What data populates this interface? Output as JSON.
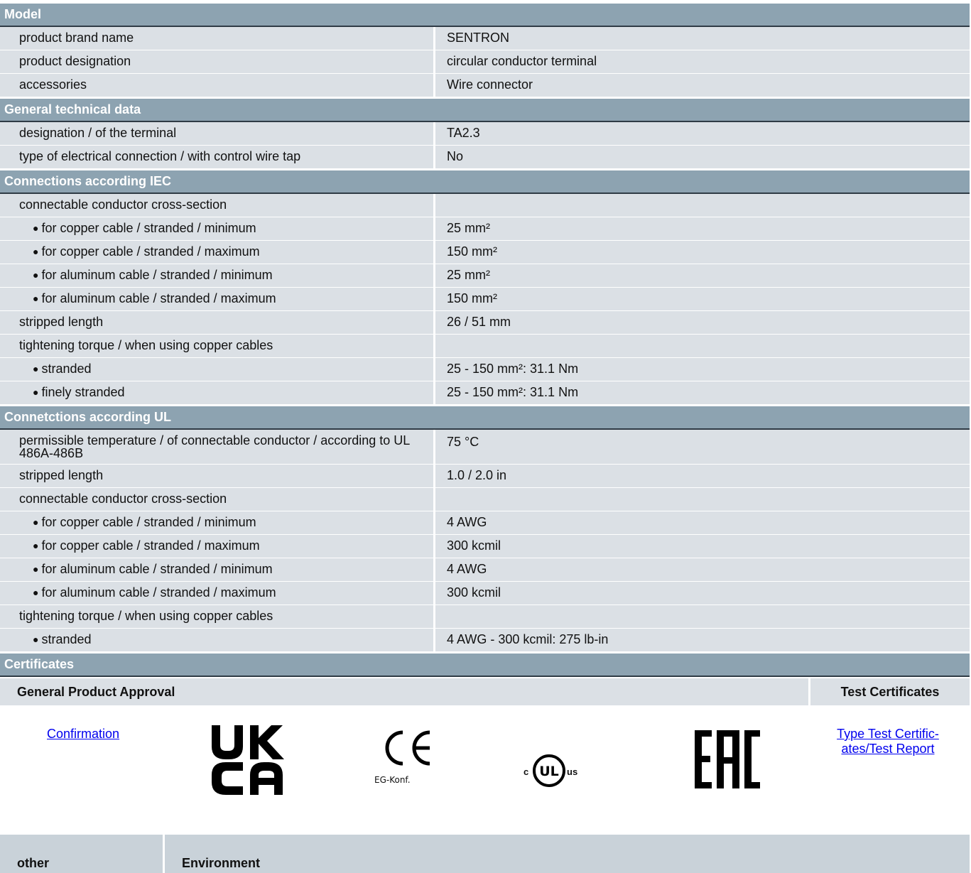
{
  "sections": {
    "model": {
      "title": "Model",
      "rows": [
        {
          "label": "product brand name",
          "value": "SENTRON"
        },
        {
          "label": "product designation",
          "value": "circular conductor terminal"
        },
        {
          "label": "accessories",
          "value": "Wire connector"
        }
      ]
    },
    "general": {
      "title": "General technical data",
      "rows": [
        {
          "label": "designation / of the terminal",
          "value": "TA2.3"
        },
        {
          "label": "type of electrical connection / with control wire tap",
          "value": "No"
        }
      ]
    },
    "iec": {
      "title": "Connections according IEC",
      "cross_section_label": "connectable conductor cross-section",
      "cross_section_items": [
        {
          "label": "for copper cable / stranded / minimum",
          "value": "25 mm²"
        },
        {
          "label": "for copper cable / stranded / maximum",
          "value": "150 mm²"
        },
        {
          "label": "for aluminum cable / stranded / minimum",
          "value": "25 mm²"
        },
        {
          "label": "for aluminum cable / stranded / maximum",
          "value": "150 mm²"
        }
      ],
      "stripped_label": "stripped length",
      "stripped_value": "26 / 51 mm",
      "torque_label": "tightening torque / when using copper cables",
      "torque_items": [
        {
          "label": "stranded",
          "value": "25 - 150 mm²: 31.1 Nm"
        },
        {
          "label": "finely stranded",
          "value": "25 - 150 mm²: 31.1 Nm"
        }
      ]
    },
    "ul": {
      "title": "Connetctions according UL",
      "temp_label": "permissible temperature / of connectable conductor / according to UL 486A-486B",
      "temp_value": "75 °C",
      "stripped_label": "stripped length",
      "stripped_value": "1.0 / 2.0 in",
      "cross_section_label": "connectable conductor cross-section",
      "cross_section_items": [
        {
          "label": "for copper cable / stranded / minimum",
          "value": "4 AWG"
        },
        {
          "label": "for copper cable / stranded / maximum",
          "value": "300 kcmil"
        },
        {
          "label": "for aluminum cable / stranded / minimum",
          "value": "4 AWG"
        },
        {
          "label": "for aluminum cable / stranded / maximum",
          "value": "300 kcmil"
        }
      ],
      "torque_label": "tightening torque / when using copper cables",
      "torque_items": [
        {
          "label": "stranded",
          "value": "4 AWG - 300 kcmil: 275 lb-in"
        }
      ]
    },
    "certificates": {
      "title": "Certificates",
      "general_approval": "General Product Approval",
      "test_certificates": "Test Certificates",
      "confirmation_link": "Confirmation",
      "type_test_link_line1": "Type Test Certific-",
      "type_test_link_line2": "ates/Test Report",
      "logos": [
        "UKCA",
        "CE EG-Konf.",
        "cULus",
        "EAC"
      ],
      "ce_sub": "EG-Konf.",
      "ul_c": "c",
      "ul_us": "us"
    }
  },
  "bottom": {
    "other": "other",
    "environment": "Environment"
  },
  "colors": {
    "section_header": "#8da3b1",
    "row_bg": "#dbe0e5",
    "link": "#0000ee"
  }
}
